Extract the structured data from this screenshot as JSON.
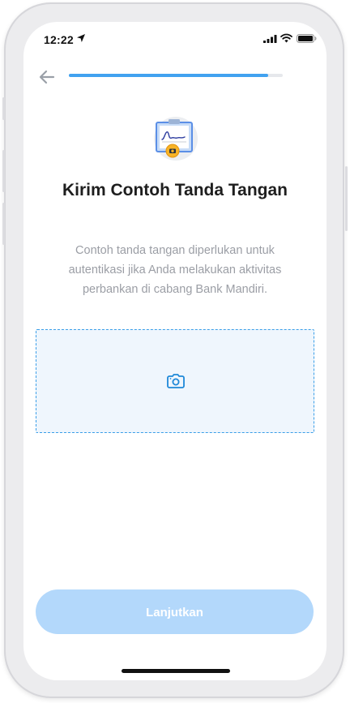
{
  "status_bar": {
    "time": "12:22"
  },
  "header": {
    "back_icon": "arrow-left-icon",
    "progress_percent": 93
  },
  "illustration": {
    "icon": "signature-document-icon"
  },
  "main": {
    "title": "Kirim Contoh Tanda Tangan",
    "description": "Contoh tanda tangan diperlukan untuk autentikasi jika Anda melakukan aktivitas perbankan di cabang Bank Mandiri."
  },
  "upload": {
    "icon": "camera-icon"
  },
  "footer": {
    "continue_label": "Lanjutkan"
  },
  "colors": {
    "accent": "#41a2f0",
    "button_disabled": "#b3d8fb",
    "upload_border": "#3a9ee8",
    "upload_bg": "#eff6fd",
    "title": "#1e1e1e",
    "description": "#9b9ea5"
  }
}
